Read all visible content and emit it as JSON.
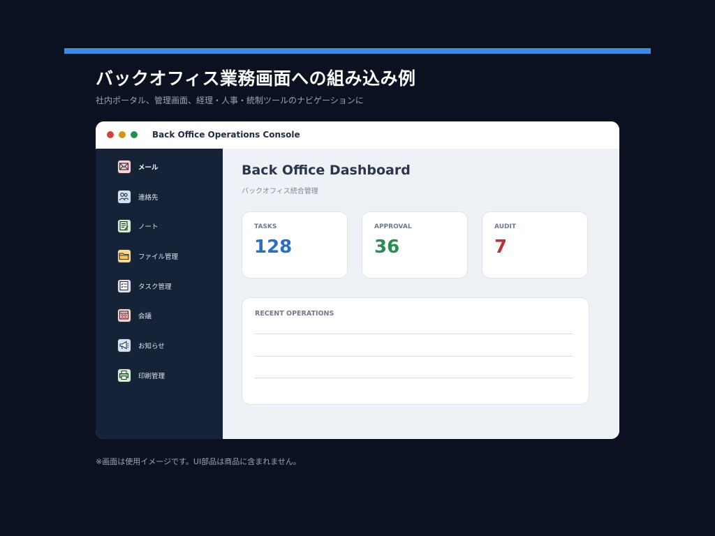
{
  "page": {
    "headline": "バックオフィス業務画面への組み込み例",
    "subline": "社内ポータル、管理画面、経理・人事・統制ツールのナビゲーションに",
    "footnote": "※画面は使用イメージです。UI部品は商品に含まれません。",
    "accent_color": "#3d8bdc"
  },
  "window": {
    "title": "Back Office Operations Console",
    "controls": [
      "close-dot",
      "minimize-dot",
      "maximize-dot"
    ]
  },
  "sidebar": {
    "items": [
      {
        "label": "メール",
        "icon": "mail-icon",
        "active": true
      },
      {
        "label": "連絡先",
        "icon": "contacts-icon",
        "active": false
      },
      {
        "label": "ノート",
        "icon": "note-icon",
        "active": false
      },
      {
        "label": "ファイル管理",
        "icon": "folder-icon",
        "active": false
      },
      {
        "label": "タスク管理",
        "icon": "task-checklist-icon",
        "active": false
      },
      {
        "label": "会議",
        "icon": "meeting-icon",
        "active": false
      },
      {
        "label": "お知らせ",
        "icon": "megaphone-icon",
        "active": false
      },
      {
        "label": "印刷管理",
        "icon": "printer-icon",
        "active": false
      }
    ]
  },
  "dashboard": {
    "title": "Back Office Dashboard",
    "subtitle": "バックオフィス統合管理",
    "stats": [
      {
        "label": "TASKS",
        "value": "128",
        "color": "#2b6fc2"
      },
      {
        "label": "APPROVAL",
        "value": "36",
        "color": "#2b8a55"
      },
      {
        "label": "AUDIT",
        "value": "7",
        "color": "#b8333a"
      }
    ],
    "recent": {
      "title": "RECENT OPERATIONS"
    }
  }
}
